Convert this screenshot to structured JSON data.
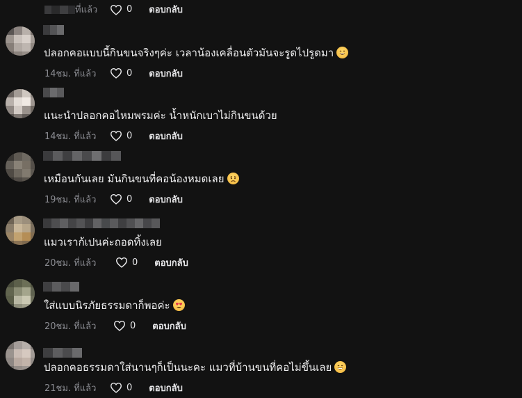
{
  "top_partial": {
    "time": "ที่แล้ว",
    "likes": "0",
    "reply": "ตอบกลับ"
  },
  "comments": [
    {
      "text": "ปลอกคอแบบนี้กินขนจริงๆค่ะ เวลาน้องเคลื่อนตัวมันจะรูดไปรูดมา",
      "emoji": "grinning-face-emoji",
      "time": "14ชม. ที่แล้ว",
      "likes": "0",
      "reply": "ตอบกลับ"
    },
    {
      "text": "แนะนำปลอกคอไหมพรมค่ะ น้ำหนักเบาไม่กินขนด้วย",
      "emoji": "",
      "time": "14ชม. ที่แล้ว",
      "likes": "0",
      "reply": "ตอบกลับ"
    },
    {
      "text": "เหมือนกันเลย มันกินขนที่คอน้องหมดเลย",
      "emoji": "worried-face-emoji",
      "time": "19ชม. ที่แล้ว",
      "likes": "0",
      "reply": "ตอบกลับ"
    },
    {
      "text": "แมวเราก้เปนค่ะถอดทิ้งเลย",
      "emoji": "",
      "time": "20ชม. ที่แล้ว",
      "likes": "0",
      "reply": "ตอบกลับ"
    },
    {
      "text": "ใส่แบบนิรภัยธรรมดาก็พอค่ะ",
      "emoji": "heart-eyes-emoji",
      "time": "20ชม. ที่แล้ว",
      "likes": "0",
      "reply": "ตอบกลับ"
    },
    {
      "text": "ปลอกคอธรรมดาใส่นานๆก็เป็นนะคะ แมวที่บ้านขนที่คอไม่ขึ้นเลย",
      "emoji": "grinning-face-emoji",
      "time": "21ชม. ที่แล้ว",
      "likes": "0",
      "reply": "ตอบกลับ"
    }
  ],
  "colors": {
    "background": "#121212",
    "text": "#eeeeef",
    "muted": "#8a8b91"
  }
}
